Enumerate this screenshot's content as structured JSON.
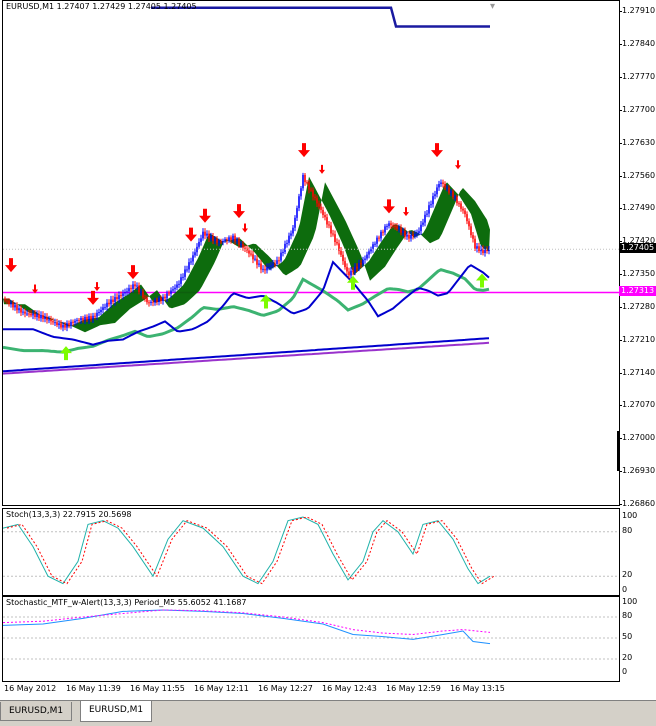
{
  "main_chart": {
    "title": "EURUSD,M1  1.27407 1.27429 1.27405 1.27405",
    "price_levels": [
      "1.27910",
      "1.27840",
      "1.27770",
      "1.27700",
      "1.27630",
      "1.27560",
      "1.27490",
      "1.27420",
      "1.27350",
      "1.27280",
      "1.27210",
      "1.27140",
      "1.27070",
      "1.27000",
      "1.26930",
      "1.26860"
    ],
    "current_price": "1.27405",
    "hline_price": "1.27313",
    "colors": {
      "bull": "#0000ff",
      "bear": "#ff0000",
      "cloud": "#006400",
      "ma_green": "#3cb371",
      "ma_blue": "#0000cd",
      "ma_purple": "#9932cc",
      "hline": "#ff00ff",
      "arrow_up": "#7cfc00",
      "arrow_down": "#ff0000"
    }
  },
  "stoch1": {
    "title": "Stoch(13,3,3) 22.7915 20.5698",
    "levels": [
      "100",
      "80",
      "20",
      "0"
    ]
  },
  "stoch2": {
    "title": "Stochastic_MTF_w-Alert(13,3,3) Period_M5 55.6052 41.1687",
    "levels": [
      "100",
      "80",
      "50",
      "20",
      "0"
    ]
  },
  "time_axis": [
    "16 May 2012",
    "16 May 11:39",
    "16 May 11:55",
    "16 May 12:11",
    "16 May 12:27",
    "16 May 12:43",
    "16 May 12:59",
    "16 May 13:15"
  ],
  "tabs": [
    {
      "label": "EURUSD,M1",
      "active": false
    },
    {
      "label": "EURUSD,M1",
      "active": true
    }
  ]
}
